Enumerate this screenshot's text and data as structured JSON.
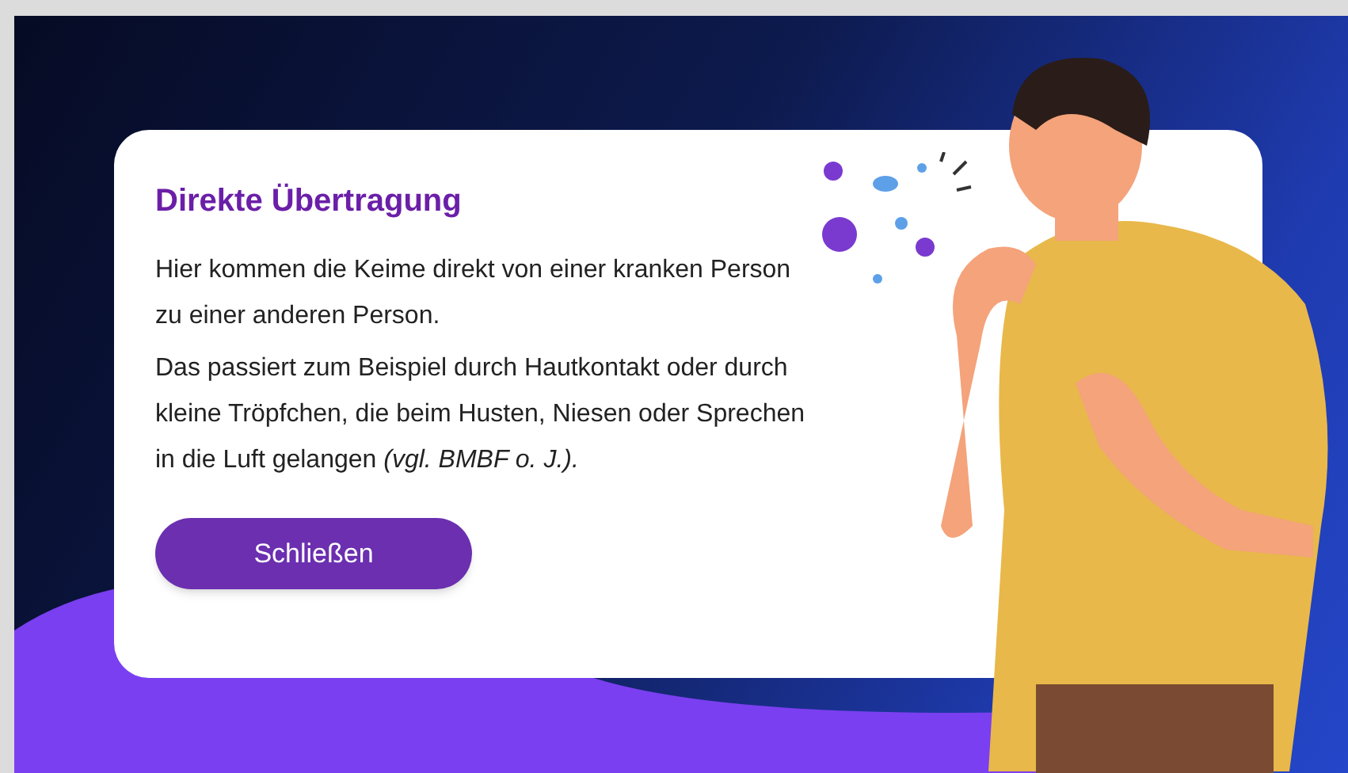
{
  "dialog": {
    "title": "Direkte Übertragung",
    "paragraphs": [
      "Hier kommen die Keime direkt von einer kranken Person zu einer anderen Person.",
      "Das passiert zum Beispiel durch Hautkontakt oder durch kleine Tröpfchen, die beim Husten, Niesen oder Sprechen in die Luft gelangen *(vgl. BMBF o. J.).*"
    ],
    "button": "Schließen"
  }
}
